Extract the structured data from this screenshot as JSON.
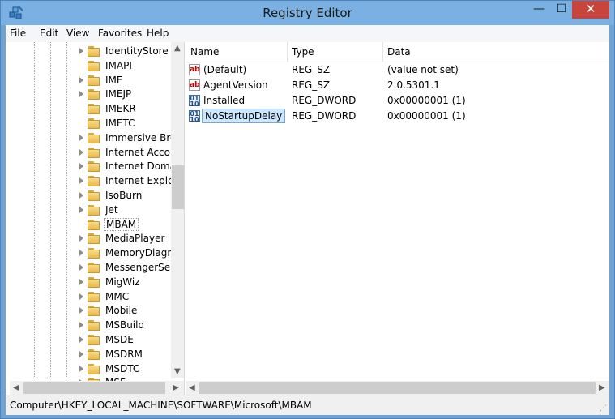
{
  "window": {
    "title": "Registry Editor"
  },
  "window_buttons": {
    "minimize": "—",
    "maximize": "☐",
    "close": "✕"
  },
  "menu": [
    "File",
    "Edit",
    "View",
    "Favorites",
    "Help"
  ],
  "tree": {
    "items": [
      {
        "label": "IdentityStore",
        "expandable": true
      },
      {
        "label": "IMAPI",
        "expandable": false
      },
      {
        "label": "IME",
        "expandable": true
      },
      {
        "label": "IMEJP",
        "expandable": true
      },
      {
        "label": "IMEKR",
        "expandable": false
      },
      {
        "label": "IMETC",
        "expandable": false
      },
      {
        "label": "Immersive Bro",
        "expandable": true
      },
      {
        "label": "Internet Accou",
        "expandable": true
      },
      {
        "label": "Internet Doma",
        "expandable": true
      },
      {
        "label": "Internet Explor",
        "expandable": true
      },
      {
        "label": "IsoBurn",
        "expandable": true
      },
      {
        "label": "Jet",
        "expandable": true
      },
      {
        "label": "MBAM",
        "expandable": false,
        "selected": true
      },
      {
        "label": "MediaPlayer",
        "expandable": true
      },
      {
        "label": "MemoryDiagn",
        "expandable": true
      },
      {
        "label": "MessengerServ",
        "expandable": true
      },
      {
        "label": "MigWiz",
        "expandable": true
      },
      {
        "label": "MMC",
        "expandable": true
      },
      {
        "label": "Mobile",
        "expandable": true
      },
      {
        "label": "MSBuild",
        "expandable": true
      },
      {
        "label": "MSDE",
        "expandable": true
      },
      {
        "label": "MSDRM",
        "expandable": true
      },
      {
        "label": "MSDTC",
        "expandable": true
      },
      {
        "label": "MSF",
        "expandable": true
      }
    ]
  },
  "values": {
    "headers": {
      "name": "Name",
      "type": "Type",
      "data": "Data"
    },
    "rows": [
      {
        "icon": "string-value-icon",
        "name": "(Default)",
        "type": "REG_SZ",
        "data": "(value not set)"
      },
      {
        "icon": "string-value-icon",
        "name": "AgentVersion",
        "type": "REG_SZ",
        "data": "2.0.5301.1"
      },
      {
        "icon": "dword-value-icon",
        "name": "Installed",
        "type": "REG_DWORD",
        "data": "0x00000001 (1)"
      },
      {
        "icon": "dword-value-icon",
        "name": "NoStartupDelay",
        "type": "REG_DWORD",
        "data": "0x00000001 (1)",
        "selected": true
      }
    ]
  },
  "status": {
    "path": "Computer\\HKEY_LOCAL_MACHINE\\SOFTWARE\\Microsoft\\MBAM"
  }
}
